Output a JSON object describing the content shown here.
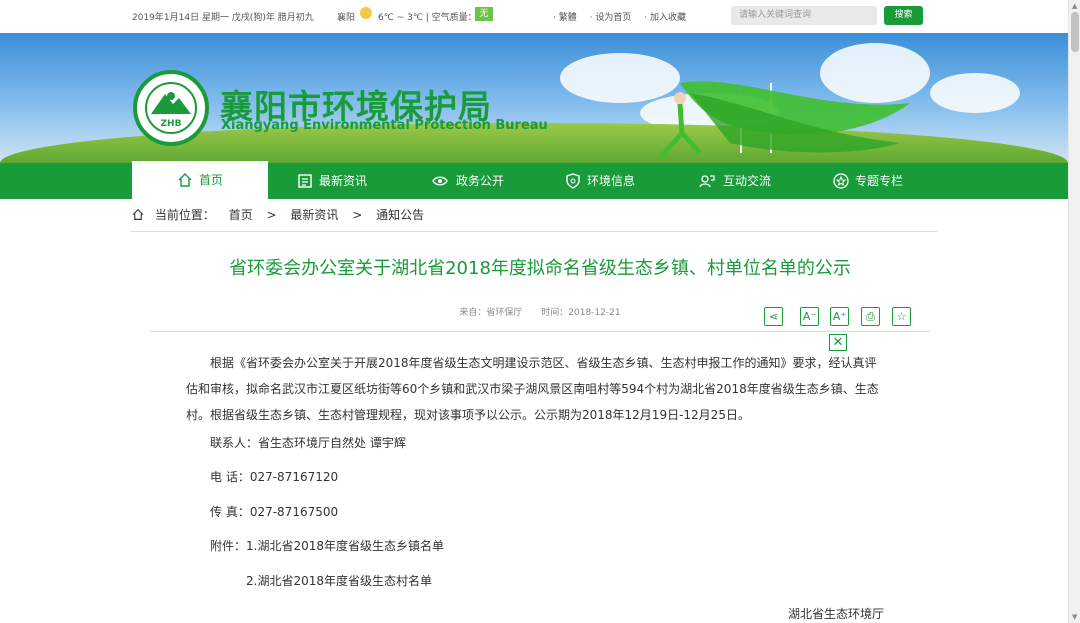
{
  "topbar": {
    "date": "2019年1月14日 星期一 戊戌(狗)年 腊月初九",
    "city": "襄阳",
    "temp": "6℃ ~ 3℃ | 空气质量：",
    "aqi": "无",
    "links": [
      "· 繁體",
      "· 设为首页",
      "· 加入收藏"
    ],
    "search_placeholder": "请输入关键词查询",
    "search_button": "搜索"
  },
  "header": {
    "logo_text": "ZHB",
    "name_cn": "襄阳市环境保护局",
    "name_en": "Xiangyang Environmental Protection Bureau"
  },
  "nav": [
    {
      "label": "首页",
      "icon": "home-icon"
    },
    {
      "label": "最新资讯",
      "icon": "news-icon"
    },
    {
      "label": "政务公开",
      "icon": "eye-icon"
    },
    {
      "label": "环境信息",
      "icon": "shield-icon"
    },
    {
      "label": "互动交流",
      "icon": "chat-icon"
    },
    {
      "label": "专题专栏",
      "icon": "star-icon"
    }
  ],
  "breadcrumb": {
    "prefix": "当前位置：",
    "items": [
      "首页",
      "最新资讯",
      "通知公告"
    ],
    "sep": ">"
  },
  "article": {
    "title": "省环委会办公室关于湖北省2018年度拟命名省级生态乡镇、村单位名单的公示",
    "source": "来自：省环保厅",
    "time": "时间：2018-12-21",
    "paragraph": "根据《省环委会办公室关于开展2018年度省级生态文明建设示范区、省级生态乡镇、生态村申报工作的通知》要求，经认真评估和审核，拟命名武汉市江夏区纸坊街等60个乡镇和武汉市梁子湖风景区南咀村等594个村为湖北省2018年度省级生态乡镇、生态村。根据省级生态乡镇、生态村管理规程，现对该事项予以公示。公示期为2018年12月19日-12月25日。",
    "contact": "联系人：省生态环境厅自然处  谭宇辉",
    "phone": "电  话：027-87167120",
    "fax": "传  真：027-87167500",
    "attach1": "附件：1.湖北省2018年度省级生态乡镇名单",
    "attach2": "2.湖北省2018年度省级生态村名单",
    "signature": "湖北省生态环境厅"
  },
  "tools": [
    "share-icon",
    "font-decrease-icon",
    "font-increase-icon",
    "print-icon",
    "favorite-icon"
  ],
  "colors": {
    "brand": "#1a9b3a",
    "aqi": "#6cc24a"
  }
}
